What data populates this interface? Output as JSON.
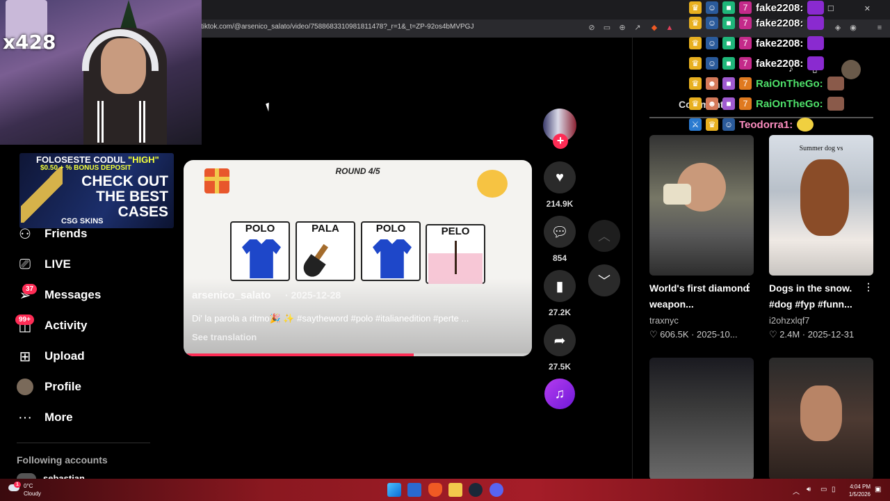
{
  "browser": {
    "url": "tiktok.com/@arsenico_salato/video/7588683310981811478?_r=1&_t=ZP-92os4bMVPGJ"
  },
  "stream_overlay": {
    "viewer_multiplier": "x428",
    "ad": {
      "line1_prefix": "FOLOSESTE CODUL",
      "line1_code": "\"HIGH\"",
      "line2": "$0.50 + % BONUS DEPOSIT",
      "line3": "CHECK OUT THE BEST CASES",
      "brand": "CSG SKINS"
    },
    "chat": [
      {
        "name": "fake2208:",
        "color": "#ffffff",
        "icons": [
          "crown-icon",
          "bot-icon",
          "gift-icon",
          "badge-icon"
        ]
      },
      {
        "name": "fake2208:",
        "color": "#ffffff",
        "icons": [
          "crown-icon",
          "bot-icon",
          "gift-icon",
          "badge-icon"
        ]
      },
      {
        "name": "fake2208:",
        "color": "#ffffff",
        "icons": [
          "crown-icon",
          "bot-icon",
          "gift-icon",
          "badge-icon"
        ]
      },
      {
        "name": "fake2208:",
        "color": "#ffffff",
        "icons": [
          "crown-icon",
          "bot-icon",
          "gift-icon",
          "badge-icon"
        ]
      },
      {
        "name": "RaiOnTheGo:",
        "color": "#4fe06a",
        "icons": [
          "crown-icon",
          "person-icon",
          "gift-icon",
          "badge-icon"
        ]
      },
      {
        "name": "RaiOnTheGo:",
        "color": "#4fe06a",
        "icons": [
          "crown-icon",
          "person-icon",
          "gift-icon",
          "badge-icon"
        ]
      },
      {
        "name": "Teodorra1:",
        "color": "#ff8fc2",
        "icons": [
          "sword-icon",
          "crown-icon",
          "bot-icon"
        ]
      }
    ]
  },
  "sidebar": {
    "items": [
      {
        "label": "Friends",
        "icon": "friends-icon"
      },
      {
        "label": "LIVE",
        "icon": "live-icon"
      },
      {
        "label": "Messages",
        "icon": "messages-icon",
        "badge": "37"
      },
      {
        "label": "Activity",
        "icon": "activity-icon",
        "badge": "99+"
      },
      {
        "label": "Upload",
        "icon": "upload-icon"
      },
      {
        "label": "Profile",
        "icon": "profile-avatar"
      },
      {
        "label": "More",
        "icon": "more-icon"
      }
    ],
    "following_title": "Following accounts",
    "following_first": "sebastian"
  },
  "video": {
    "round_label": "ROUND 4/5",
    "tiles": [
      "POLO",
      "PALA",
      "POLO",
      "PELO"
    ],
    "author": "arsenico_salato",
    "date": "· 2025-12-28",
    "description": "Di' la parola a ritmo🎉 ✨ #saytheword #polo #italianedition #perte ...",
    "see_translation": "See translation",
    "progress": 0.66
  },
  "actions": {
    "likes": "214.9K",
    "comments": "854",
    "saves": "27.2K",
    "shares": "27.5K"
  },
  "right_panel": {
    "comments_tab": "Comments",
    "recommended": [
      {
        "title": "World's first diamond weapon...",
        "author": "traxnyc",
        "likes": "606.5K",
        "date": "2025-10..."
      },
      {
        "title": "Dogs in the snow. #dog #fyp #funn...",
        "author": "i2ohzxlqf7",
        "likes": "2.4M",
        "date": "2025-12-31",
        "thumb_caption": "Summer dog vs"
      }
    ]
  },
  "taskbar": {
    "temp": "0°C",
    "weather": "Cloudy",
    "weather_badge": "1",
    "time": "4:04 PM",
    "date": "1/5/2026"
  }
}
